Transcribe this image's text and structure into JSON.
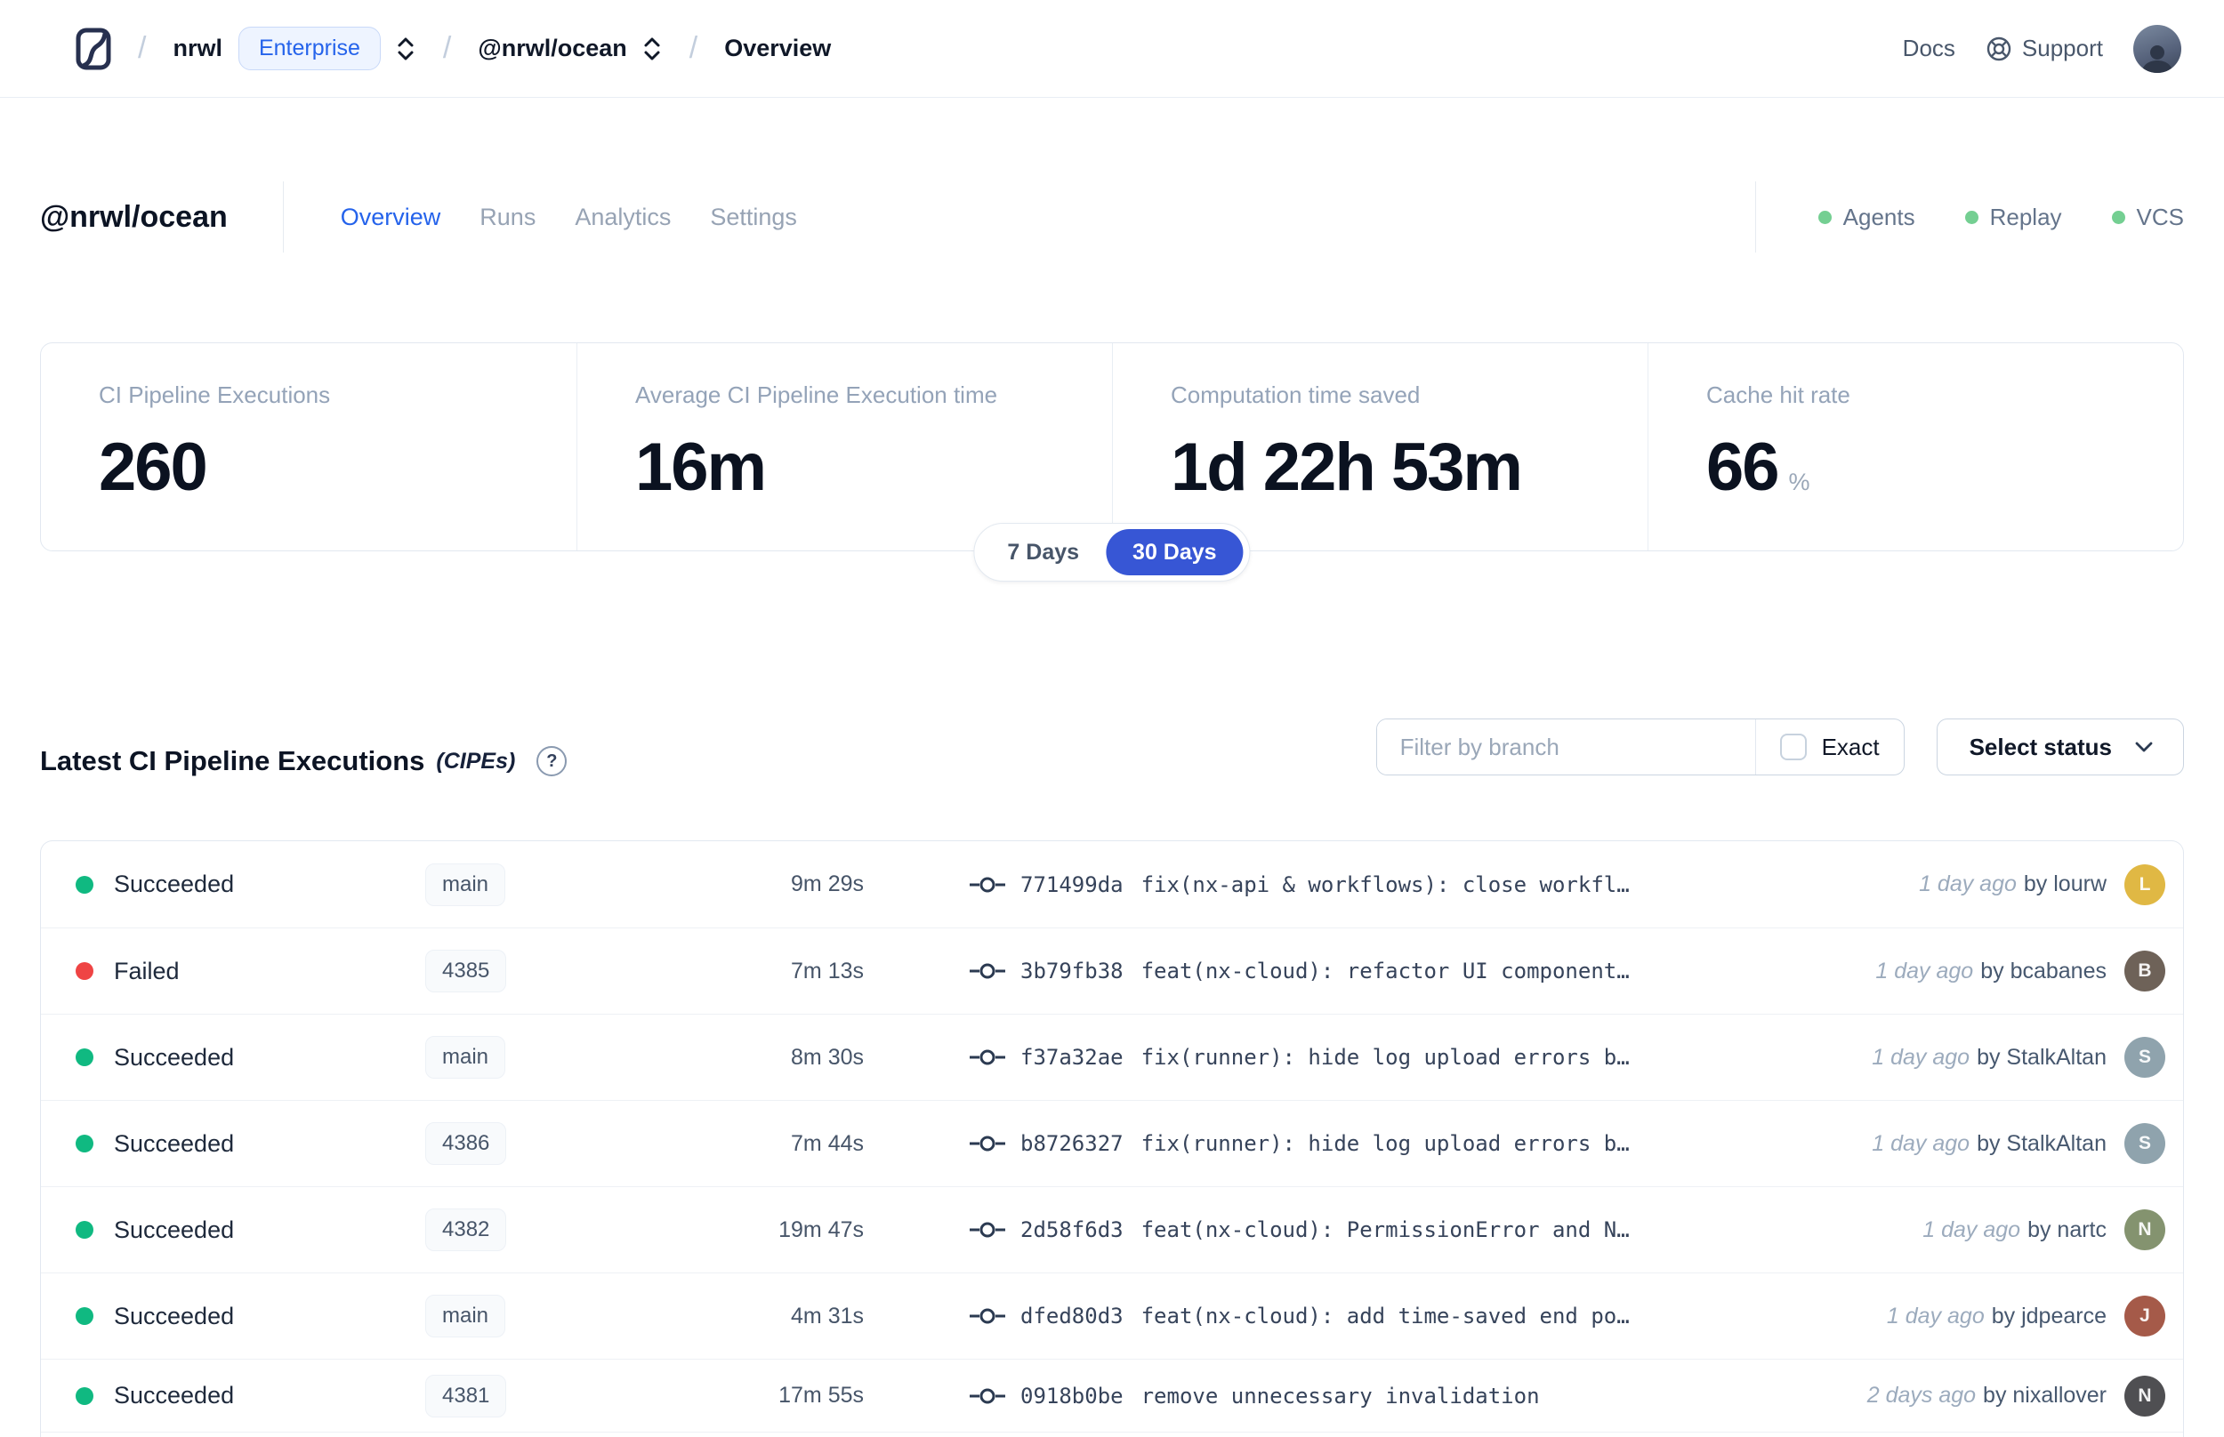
{
  "colors": {
    "accent_blue": "#2563eb",
    "toggle_selected_blue": "#3756d5",
    "succeeded_green": "#10b981",
    "failed_red": "#ef4444",
    "service_dot_green": "#74cf92"
  },
  "topnav": {
    "logo": "nx-cloud-logo",
    "breadcrumb": {
      "org": "nrwl",
      "org_badge": "Enterprise",
      "workspace": "@nrwl/ocean",
      "page": "Overview"
    },
    "docs_label": "Docs",
    "support_label": "Support"
  },
  "workspace_header": {
    "title": "@nrwl/ocean",
    "tabs": [
      {
        "label": "Overview",
        "active": true
      },
      {
        "label": "Runs",
        "active": false
      },
      {
        "label": "Analytics",
        "active": false
      },
      {
        "label": "Settings",
        "active": false
      }
    ],
    "services": [
      {
        "label": "Agents"
      },
      {
        "label": "Replay"
      },
      {
        "label": "VCS"
      }
    ]
  },
  "stats": {
    "cards": [
      {
        "label": "CI Pipeline Executions",
        "value": "260",
        "suffix": ""
      },
      {
        "label": "Average CI Pipeline Execution time",
        "value": "16m",
        "suffix": ""
      },
      {
        "label": "Computation time saved",
        "value": "1d 22h 53m",
        "suffix": ""
      },
      {
        "label": "Cache hit rate",
        "value": "66",
        "suffix": "%"
      }
    ],
    "range_toggle": [
      {
        "label": "7 Days",
        "selected": false
      },
      {
        "label": "30 Days",
        "selected": true
      }
    ]
  },
  "cipes": {
    "title": "Latest CI Pipeline Executions",
    "title_abbrev": "(CIPEs)",
    "filter_placeholder": "Filter by branch",
    "exact_label": "Exact",
    "status_select_label": "Select status",
    "rows": [
      {
        "status": "Succeeded",
        "status_color": "#10b981",
        "branch": "main",
        "duration": "9m 29s",
        "commit": "771499da",
        "message": "fix(nx-api & workflows): close workfl…",
        "time_ago": "1 day ago",
        "author_prefix": "by",
        "author": "lourw",
        "avatar_color": "#e0b844"
      },
      {
        "status": "Failed",
        "status_color": "#ef4444",
        "branch": "4385",
        "duration": "7m 13s",
        "commit": "3b79fb38",
        "message": "feat(nx-cloud): refactor UI component…",
        "time_ago": "1 day ago",
        "author_prefix": "by",
        "author": "bcabanes",
        "avatar_color": "#6e6258"
      },
      {
        "status": "Succeeded",
        "status_color": "#10b981",
        "branch": "main",
        "duration": "8m 30s",
        "commit": "f37a32ae",
        "message": "fix(runner): hide log upload errors b…",
        "time_ago": "1 day ago",
        "author_prefix": "by",
        "author": "StalkAltan",
        "avatar_color": "#8fa3ad"
      },
      {
        "status": "Succeeded",
        "status_color": "#10b981",
        "branch": "4386",
        "duration": "7m 44s",
        "commit": "b8726327",
        "message": "fix(runner): hide log upload errors b…",
        "time_ago": "1 day ago",
        "author_prefix": "by",
        "author": "StalkAltan",
        "avatar_color": "#8fa3ad"
      },
      {
        "status": "Succeeded",
        "status_color": "#10b981",
        "branch": "4382",
        "duration": "19m 47s",
        "commit": "2d58f6d3",
        "message": "feat(nx-cloud): PermissionError and N…",
        "time_ago": "1 day ago",
        "author_prefix": "by",
        "author": "nartc",
        "avatar_color": "#84936f"
      },
      {
        "status": "Succeeded",
        "status_color": "#10b981",
        "branch": "main",
        "duration": "4m 31s",
        "commit": "dfed80d3",
        "message": "feat(nx-cloud): add time-saved end po…",
        "time_ago": "1 day ago",
        "author_prefix": "by",
        "author": "jdpearce",
        "avatar_color": "#a55a49"
      },
      {
        "status": "Succeeded",
        "status_color": "#10b981",
        "branch": "4381",
        "duration": "17m 55s",
        "commit": "0918b0be",
        "message": "remove unnecessary invalidation",
        "time_ago": "2 days ago",
        "author_prefix": "by",
        "author": "nixallover",
        "avatar_color": "#4f4f52"
      }
    ]
  }
}
